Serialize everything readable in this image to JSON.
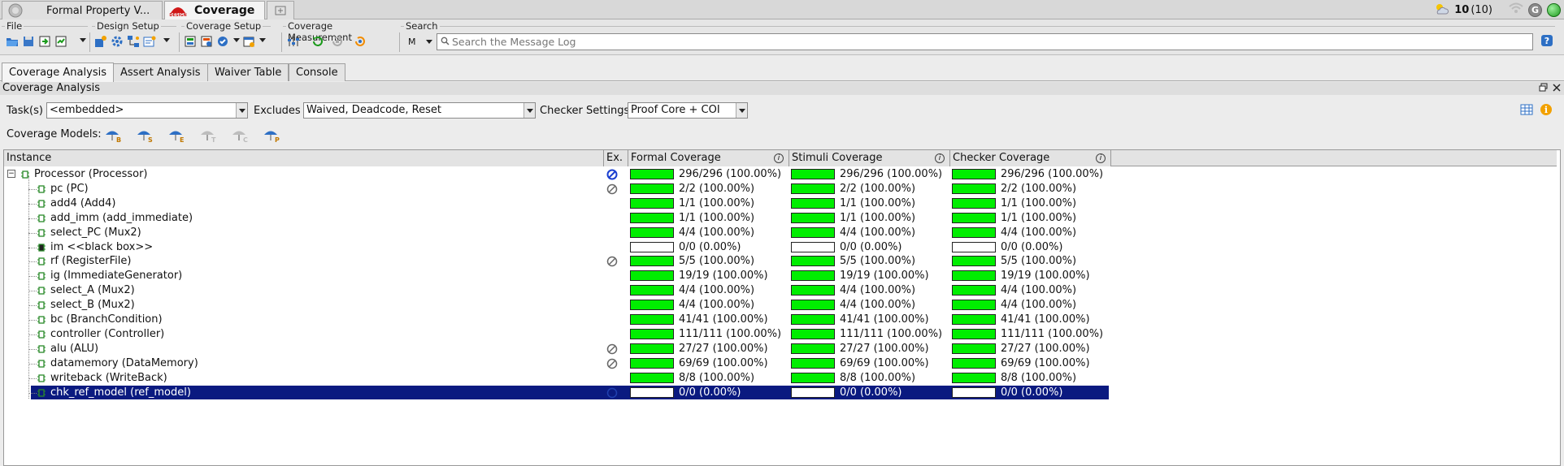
{
  "app_tabs": [
    {
      "label": "Formal Property V...",
      "active": false
    },
    {
      "label": "Coverage",
      "active": true
    }
  ],
  "tab_logo_text": "DESIGN",
  "status": {
    "count": "10",
    "count_total": "(10)"
  },
  "toolbar": {
    "groups": {
      "file": "File",
      "design_setup": "Design Setup",
      "coverage_setup": "Coverage Setup",
      "coverage_measurement": "Coverage Measurement",
      "search": "Search"
    },
    "search_mode": "M",
    "search_placeholder": "Search the Message Log"
  },
  "main_tabs": [
    "Coverage Analysis",
    "Assert Analysis",
    "Waiver Table",
    "Console"
  ],
  "panel_title": "Coverage Analysis",
  "task_row": {
    "tasks_label": "Task(s)",
    "tasks_value": "<embedded>",
    "excludes_label": "Excludes",
    "excludes_value": "Waived, Deadcode, Reset",
    "checker_label": "Checker Settings",
    "checker_value": "Proof Core + COI"
  },
  "coverage_models_label": "Coverage Models:",
  "coverage_models": [
    "B",
    "S",
    "E",
    "T",
    "C",
    "P"
  ],
  "columns": {
    "instance": "Instance",
    "ex": "Ex.",
    "formal": "Formal Coverage",
    "stimuli": "Stimuli Coverage",
    "checker": "Checker Coverage"
  },
  "colors": {
    "bar_full": "#00ee00",
    "selection": "#0a1a80"
  },
  "rows": [
    {
      "instance": "Processor (Processor)",
      "ex": "blocked",
      "formal": "296/296 (100.00%)",
      "stimuli": "296/296 (100.00%)",
      "checker": "296/296 (100.00%)",
      "full": true
    },
    {
      "instance": "pc (PC)",
      "ex": "partial",
      "formal": "2/2 (100.00%)",
      "stimuli": "2/2 (100.00%)",
      "checker": "2/2 (100.00%)",
      "full": true
    },
    {
      "instance": "add4 (Add4)",
      "ex": "",
      "formal": "1/1 (100.00%)",
      "stimuli": "1/1 (100.00%)",
      "checker": "1/1 (100.00%)",
      "full": true
    },
    {
      "instance": "add_imm (add_immediate)",
      "ex": "",
      "formal": "1/1 (100.00%)",
      "stimuli": "1/1 (100.00%)",
      "checker": "1/1 (100.00%)",
      "full": true
    },
    {
      "instance": "select_PC (Mux2)",
      "ex": "",
      "formal": "4/4 (100.00%)",
      "stimuli": "4/4 (100.00%)",
      "checker": "4/4 (100.00%)",
      "full": true
    },
    {
      "instance": "im <<black box>>",
      "ex": "",
      "formal": "0/0 (0.00%)",
      "stimuli": "0/0 (0.00%)",
      "checker": "0/0 (0.00%)",
      "full": false,
      "blackbox": true
    },
    {
      "instance": "rf (RegisterFile)",
      "ex": "partial",
      "formal": "5/5 (100.00%)",
      "stimuli": "5/5 (100.00%)",
      "checker": "5/5 (100.00%)",
      "full": true
    },
    {
      "instance": "ig (ImmediateGenerator)",
      "ex": "",
      "formal": "19/19 (100.00%)",
      "stimuli": "19/19 (100.00%)",
      "checker": "19/19 (100.00%)",
      "full": true
    },
    {
      "instance": "select_A (Mux2)",
      "ex": "",
      "formal": "4/4 (100.00%)",
      "stimuli": "4/4 (100.00%)",
      "checker": "4/4 (100.00%)",
      "full": true
    },
    {
      "instance": "select_B (Mux2)",
      "ex": "",
      "formal": "4/4 (100.00%)",
      "stimuli": "4/4 (100.00%)",
      "checker": "4/4 (100.00%)",
      "full": true
    },
    {
      "instance": "bc (BranchCondition)",
      "ex": "",
      "formal": "41/41 (100.00%)",
      "stimuli": "41/41 (100.00%)",
      "checker": "41/41 (100.00%)",
      "full": true
    },
    {
      "instance": "controller (Controller)",
      "ex": "",
      "formal": "111/111 (100.00%)",
      "stimuli": "111/111 (100.00%)",
      "checker": "111/111 (100.00%)",
      "full": true
    },
    {
      "instance": "alu (ALU)",
      "ex": "partial",
      "formal": "27/27 (100.00%)",
      "stimuli": "27/27 (100.00%)",
      "checker": "27/27 (100.00%)",
      "full": true
    },
    {
      "instance": "datamemory (DataMemory)",
      "ex": "partial",
      "formal": "69/69 (100.00%)",
      "stimuli": "69/69 (100.00%)",
      "checker": "69/69 (100.00%)",
      "full": true
    },
    {
      "instance": "writeback (WriteBack)",
      "ex": "",
      "formal": "8/8 (100.00%)",
      "stimuli": "8/8 (100.00%)",
      "checker": "8/8 (100.00%)",
      "full": true
    },
    {
      "instance": "chk_ref_model (ref_model)",
      "ex": "",
      "formal": "0/0 (0.00%)",
      "stimuli": "0/0 (0.00%)",
      "checker": "0/0 (0.00%)",
      "full": false,
      "selected": true
    }
  ]
}
